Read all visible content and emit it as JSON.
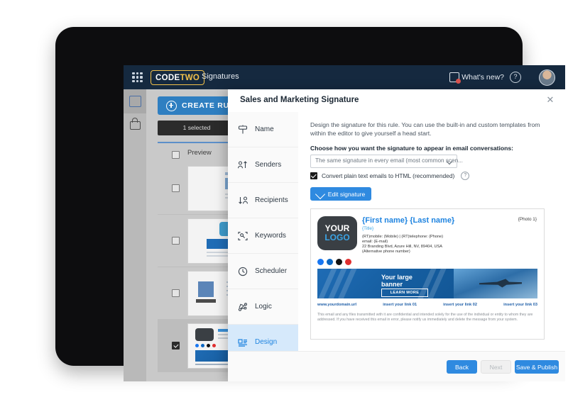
{
  "appbar": {
    "waffle_icon": "app-grid-icon",
    "logo_code": "CODE",
    "logo_two": "TWO",
    "title": "Signatures",
    "whats_new": "What's new?",
    "help_icon": "?",
    "avatar": "user-avatar"
  },
  "background_app": {
    "create_rule": "CREATE RULE",
    "selected_label": "1 selected",
    "preview_column": "Preview",
    "rows": [
      {
        "selected": false
      },
      {
        "selected": false
      },
      {
        "selected": false
      },
      {
        "selected": true
      }
    ],
    "company_thumb_label": "company",
    "expander_icon": "chevron-right-icon"
  },
  "modal": {
    "title": "Sales and Marketing Signature",
    "close_icon": "✕",
    "nav": [
      {
        "label": "Name",
        "icon": "signpost-icon",
        "active": false
      },
      {
        "label": "Senders",
        "icon": "senders-icon",
        "active": false
      },
      {
        "label": "Recipients",
        "icon": "recipients-icon",
        "active": false
      },
      {
        "label": "Keywords",
        "icon": "keywords-icon",
        "active": false
      },
      {
        "label": "Scheduler",
        "icon": "clock-icon",
        "active": false
      },
      {
        "label": "Logic",
        "icon": "logic-icon",
        "active": false
      },
      {
        "label": "Design",
        "icon": "design-icon",
        "active": true
      }
    ],
    "body": {
      "intro": "Design the signature for this rule. You can use the built-in and custom templates from within the editor to give yourself a head start.",
      "question_label": "Choose how you want the signature to appear in email conversations:",
      "select_value": "The same signature in every email (most common scen...",
      "convert_checkbox_label": "Convert plain text emails to HTML (recommended)",
      "convert_checkbox_checked": true,
      "help_icon": "?",
      "edit_signature": "Edit signature"
    },
    "signature": {
      "logo_line1": "YOUR",
      "logo_line2": "LOGO",
      "name": "{First name} {Last name}",
      "title": "{Title}",
      "photo": "{Photo 1}",
      "contact_line": "(RT)mobile: (Mobile)  |  (RT)telephone: (Phone)",
      "email_line": "email: (E-mail)",
      "address_line": "22 Branding Blvd, Azure Hill, NV, 89404, USA",
      "alt_phone_line": "(Alternative phone number)",
      "socials": [
        "facebook-icon",
        "linkedin-icon",
        "x-icon",
        "youtube-icon"
      ],
      "banner_text_line1": "Your large",
      "banner_text_line2": "banner",
      "banner_cta": "LEARN MORE",
      "links": [
        "www.yourdomain.url",
        "insert your link 01",
        "insert your link 02",
        "insert your link 03"
      ],
      "disclaimer": "This email and any files transmitted with it are confidential and intended solely for the use of the individual or entity to whom they are addressed. If you have received this email in error, please notify us immediately and delete the message from your system."
    },
    "footer": {
      "back": "Back",
      "next": "Next",
      "save": "Save & Publish"
    }
  },
  "colors": {
    "appbar_bg": "#15293f",
    "accent_blue": "#2f8ae0",
    "logo_yellow": "#f2c14a",
    "active_nav_bg": "#d6e9fb",
    "active_nav_text": "#1f84e0"
  }
}
